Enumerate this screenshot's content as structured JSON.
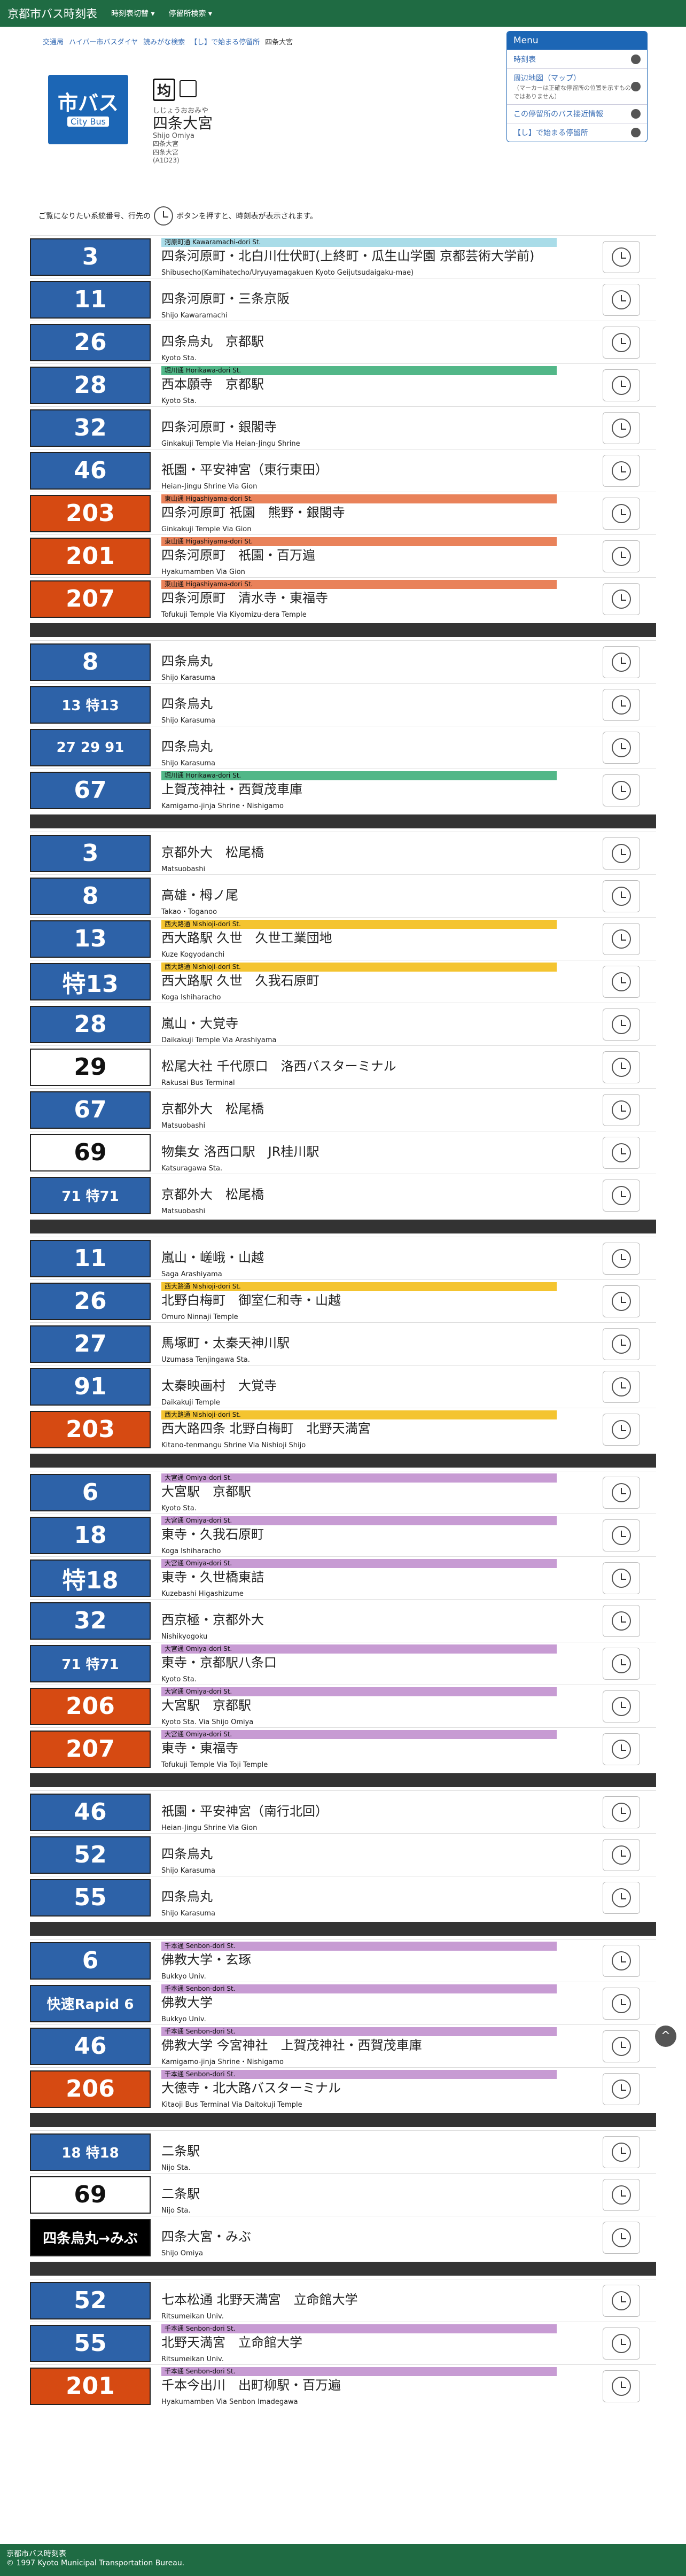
{
  "topbar": {
    "brand": "京都市バス時刻表",
    "menu1": "時刻表切替 ▾",
    "menu2": "停留所検索 ▾"
  },
  "breadcrumb": [
    "交通局",
    "ハイパー市バスダイヤ",
    "読みがな検索",
    "【し】で始まる停留所",
    "四条大宮"
  ],
  "stop": {
    "logo_big": "市バス",
    "logo_small": "City Bus",
    "kanji_glyph": "均",
    "yomi": "しじょうおおみや",
    "name": "四条大宮",
    "romaji": "Shijo Omiya",
    "sub": [
      "四条大宮",
      "四条大宮",
      "(A1D23)"
    ]
  },
  "menu": {
    "title": "Menu",
    "items": [
      "時刻表",
      "周辺地図（マップ）",
      "この停留所のバス接近情報",
      "【し】で始まる停留所"
    ],
    "map_note": "（マーカーは正確な停留所の位置を示すものではありません）"
  },
  "instruction": {
    "before": "ご覧になりたい系統番号、行先の",
    "after": "ボタンを押すと、時刻表が表示されます。"
  },
  "routes": [
    {
      "n": "3",
      "c": "blue",
      "band": "河原町通 Kawaramachi-dori St.",
      "bc": "#a9dce8",
      "dest": "四条河原町・北白川仕伏町(上終町・瓜生山学園 京都芸術大学前)",
      "rom": "Shibusecho(Kamihatecho/Uryuyamagakuen Kyoto Geijutsudaigaku-mae)"
    },
    {
      "n": "11",
      "c": "blue",
      "dest": "四条河原町・三条京阪",
      "rom": "Shijo Kawaramachi"
    },
    {
      "n": "26",
      "c": "blue",
      "dest": "四条烏丸　京都駅",
      "rom": "Kyoto Sta."
    },
    {
      "n": "28",
      "c": "blue",
      "band": "堀川通 Horikawa-dori St.",
      "bc": "#52b788",
      "dest": "西本願寺　京都駅",
      "rom": "Kyoto Sta."
    },
    {
      "n": "32",
      "c": "blue",
      "dest": "四条河原町・銀閣寺",
      "rom": "Ginkakuji Temple Via Heian-Jingu Shrine"
    },
    {
      "n": "46",
      "c": "blue",
      "dest": "祇園・平安神宮（東行東田）",
      "rom": "Heian-Jingu Shrine Via Gion"
    },
    {
      "n": "203",
      "c": "orange",
      "band": "東山通 Higashiyama-dori St.",
      "bc": "#e9825a",
      "dest": "四条河原町 祇園　熊野・銀閣寺",
      "rom": "Ginkakuji Temple Via Gion"
    },
    {
      "n": "201",
      "c": "orange",
      "band": "東山通 Higashiyama-dori St.",
      "bc": "#e9825a",
      "dest": "四条河原町　祇園・百万遍",
      "rom": "Hyakumamben Via Gion"
    },
    {
      "n": "207",
      "c": "orange",
      "band": "東山通 Higashiyama-dori St.",
      "bc": "#e9825a",
      "dest": "四条河原町　清水寺・東福寺",
      "rom": "Tofukuji Temple Via Kiyomizu-dera Temple"
    },
    {
      "sep": true
    },
    {
      "n": "8",
      "c": "blue",
      "dest": "四条烏丸",
      "rom": "Shijo Karasuma"
    },
    {
      "n": "13 特13",
      "c": "blue",
      "dest": "四条烏丸",
      "rom": "Shijo Karasuma"
    },
    {
      "n": "27 29 91",
      "c": "blue",
      "dest": "四条烏丸",
      "rom": "Shijo Karasuma"
    },
    {
      "n": "67",
      "c": "blue",
      "band": "堀川通 Horikawa-dori St.",
      "bc": "#52b788",
      "dest": "上賀茂神社・西賀茂車庫",
      "rom": "Kamigamo-jinja Shrine・Nishigamo"
    },
    {
      "sep": true
    },
    {
      "n": "3",
      "c": "blue",
      "dest": "京都外大　松尾橋",
      "rom": "Matsuobashi"
    },
    {
      "n": "8",
      "c": "blue",
      "dest": "高雄・栂ノ尾",
      "rom": "Takao・Toganoo"
    },
    {
      "n": "13",
      "c": "blue",
      "band": "西大路通 Nishioji-dori St.",
      "bc": "#f4c430",
      "dest": "西大路駅 久世　久世工業団地",
      "rom": "Kuze Kogyodanchi"
    },
    {
      "n": "特13",
      "c": "blue",
      "band": "西大路通 Nishioji-dori St.",
      "bc": "#f4c430",
      "dest": "西大路駅 久世　久我石原町",
      "rom": "Koga Ishiharacho"
    },
    {
      "n": "28",
      "c": "blue",
      "dest": "嵐山・大覚寺",
      "rom": "Daikakuji Temple Via Arashiyama"
    },
    {
      "n": "29",
      "c": "white",
      "dest": "松尾大社 千代原口　洛西バスターミナル",
      "rom": "Rakusai Bus Terminal"
    },
    {
      "n": "67",
      "c": "blue",
      "dest": "京都外大　松尾橋",
      "rom": "Matsuobashi"
    },
    {
      "n": "69",
      "c": "white",
      "dest": "物集女 洛西口駅　JR桂川駅",
      "rom": "Katsuragawa Sta."
    },
    {
      "n": "71 特71",
      "c": "blue",
      "dest": "京都外大　松尾橋",
      "rom": "Matsuobashi"
    },
    {
      "sep": true
    },
    {
      "n": "11",
      "c": "blue",
      "dest": "嵐山・嵯峨・山越",
      "rom": "Saga Arashiyama"
    },
    {
      "n": "26",
      "c": "blue",
      "band": "西大路通 Nishioji-dori St.",
      "bc": "#f4c430",
      "dest": "北野白梅町　御室仁和寺・山越",
      "rom": "Omuro Ninnaji Temple"
    },
    {
      "n": "27",
      "c": "blue",
      "dest": "馬塚町・太秦天神川駅",
      "rom": "Uzumasa Tenjingawa Sta."
    },
    {
      "n": "91",
      "c": "blue",
      "dest": "太秦映画村　大覚寺",
      "rom": "Daikakuji Temple"
    },
    {
      "n": "203",
      "c": "orange",
      "band": "西大路通 Nishioji-dori St.",
      "bc": "#f4c430",
      "dest": "西大路四条 北野白梅町　北野天満宮",
      "rom": "Kitano-tenmangu Shrine Via Nishioji Shijo"
    },
    {
      "sep": true
    },
    {
      "n": "6",
      "c": "blue",
      "band": "大宮通 Omiya-dori St.",
      "bc": "#c79bd3",
      "dest": "大宮駅　京都駅",
      "rom": "Kyoto Sta."
    },
    {
      "n": "18",
      "c": "blue",
      "band": "大宮通 Omiya-dori St.",
      "bc": "#c79bd3",
      "dest": "東寺・久我石原町",
      "rom": "Koga Ishiharacho"
    },
    {
      "n": "特18",
      "c": "blue",
      "band": "大宮通 Omiya-dori St.",
      "bc": "#c79bd3",
      "dest": "東寺・久世橋東詰",
      "rom": "Kuzebashi Higashizume"
    },
    {
      "n": "32",
      "c": "blue",
      "dest": "西京極・京都外大",
      "rom": "Nishikyogoku"
    },
    {
      "n": "71 特71",
      "c": "blue",
      "band": "大宮通 Omiya-dori St.",
      "bc": "#c79bd3",
      "dest": "東寺・京都駅八条口",
      "rom": "Kyoto Sta."
    },
    {
      "n": "206",
      "c": "orange",
      "band": "大宮通 Omiya-dori St.",
      "bc": "#c79bd3",
      "dest": "大宮駅　京都駅",
      "rom": "Kyoto Sta. Via Shijo Omiya"
    },
    {
      "n": "207",
      "c": "orange",
      "band": "大宮通 Omiya-dori St.",
      "bc": "#c79bd3",
      "dest": "東寺・東福寺",
      "rom": "Tofukuji Temple Via Toji Temple"
    },
    {
      "sep": true
    },
    {
      "n": "46",
      "c": "blue",
      "dest": "祇園・平安神宮（南行北回）",
      "rom": "Heian-Jingu Shrine Via Gion"
    },
    {
      "n": "52",
      "c": "blue",
      "dest": "四条烏丸",
      "rom": "Shijo Karasuma"
    },
    {
      "n": "55",
      "c": "blue",
      "dest": "四条烏丸",
      "rom": "Shijo Karasuma"
    },
    {
      "sep": true
    },
    {
      "n": "6",
      "c": "blue",
      "band": "千本通 Senbon-dori St.",
      "bc": "#c79bd3",
      "dest": "佛教大学・玄琢",
      "rom": "Bukkyo Univ."
    },
    {
      "n": "快速Rapid 6",
      "c": "blue",
      "band": "千本通 Senbon-dori St.",
      "bc": "#c79bd3",
      "dest": "佛教大学",
      "rom": "Bukkyo Univ."
    },
    {
      "n": "46",
      "c": "blue",
      "band": "千本通 Senbon-dori St.",
      "bc": "#c79bd3",
      "dest": "佛教大学 今宮神社　上賀茂神社・西賀茂車庫",
      "rom": "Kamigamo-jinja Shrine・Nishigamo"
    },
    {
      "n": "206",
      "c": "orange",
      "band": "千本通 Senbon-dori St.",
      "bc": "#c79bd3",
      "dest": "大徳寺・北大路バスターミナル",
      "rom": "Kitaoji Bus Terminal Via Daitokuji Temple"
    },
    {
      "sep": true
    },
    {
      "n": "18 特18",
      "c": "blue",
      "dest": "二条駅",
      "rom": "Nijo Sta."
    },
    {
      "n": "69",
      "c": "white",
      "dest": "二条駅",
      "rom": "Nijo Sta."
    },
    {
      "n": "四条烏丸→みぶ",
      "c": "black",
      "dest": "四条大宮・みぶ",
      "rom": "Shijo Omiya"
    },
    {
      "sep": true
    },
    {
      "n": "52",
      "c": "blue",
      "dest": "七本松通 北野天満宮　立命館大学",
      "rom": "Ritsumeikan Univ."
    },
    {
      "n": "55",
      "c": "blue",
      "band": "千本通 Senbon-dori St.",
      "bc": "#c79bd3",
      "dest": "北野天満宮　立命館大学",
      "rom": "Ritsumeikan Univ."
    },
    {
      "n": "201",
      "c": "orange",
      "band": "千本通 Senbon-dori St.",
      "bc": "#c79bd3",
      "dest": "千本今出川　出町柳駅・百万遍",
      "rom": "Hyakumamben Via Senbon Imadegawa"
    }
  ],
  "footer": {
    "line1": "京都市バス時刻表",
    "line2": "© 1997 Kyoto Municipal Transportation Bureau."
  }
}
